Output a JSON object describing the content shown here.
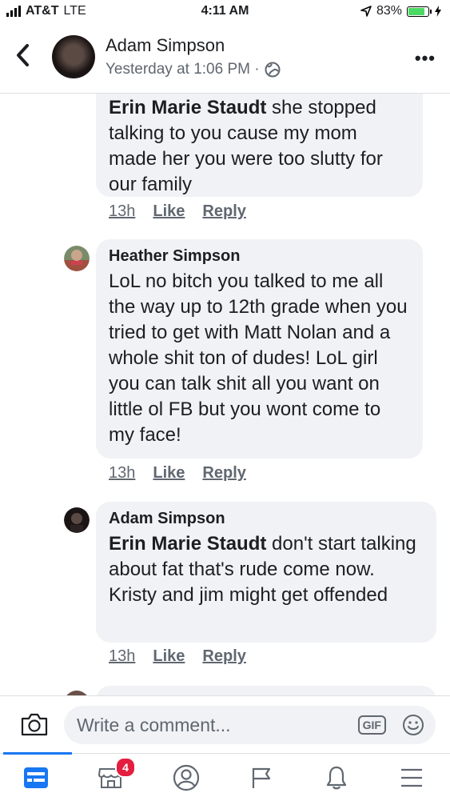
{
  "status_bar": {
    "carrier": "AT&T",
    "network": "LTE",
    "time": "4:11 AM",
    "battery": "83%",
    "battery_level": 0.83
  },
  "header": {
    "back_icon": "chevron-left-icon",
    "name": "Adam Simpson",
    "subtitle": "Yesterday at 1:06 PM ·",
    "privacy_icon": "globe-icon",
    "more_icon": "more-icon",
    "more_label": "•••"
  },
  "comments": [
    {
      "author": "",
      "mention": "Erin Marie Staudt",
      "text": " she stopped talking to you cause my mom made her you were too slutty for our family",
      "time": "13h",
      "like": "Like",
      "reply": "Reply"
    },
    {
      "author": "Heather Simpson",
      "mention": "",
      "text": "LoL no bitch you talked to me all the way up to 12th grade when you tried to get with Matt Nolan and a whole shit ton of dudes! LoL girl you can talk shit all you want on little ol FB but you wont come to my face!",
      "time": "13h",
      "like": "Like",
      "reply": "Reply"
    },
    {
      "author": "Adam Simpson",
      "mention": "Erin Marie Staudt",
      "text": " don't start talking about fat that's rude come now. Kristy and jim might get offended",
      "time": "13h",
      "like": "Like",
      "reply": "Reply"
    }
  ],
  "composer": {
    "placeholder": "Write a comment...",
    "gif_label": "GIF",
    "camera_icon": "camera-icon",
    "emoji_icon": "smiley-icon"
  },
  "tabbar": {
    "items": [
      {
        "icon": "news-feed-icon",
        "active": true
      },
      {
        "icon": "marketplace-icon",
        "badge": "4"
      },
      {
        "icon": "profile-icon"
      },
      {
        "icon": "pages-flag-icon"
      },
      {
        "icon": "notifications-bell-icon"
      },
      {
        "icon": "menu-icon"
      }
    ]
  },
  "colors": {
    "accent": "#1877f2",
    "bubble": "#f0f2f5",
    "badge": "#e41e3f"
  }
}
